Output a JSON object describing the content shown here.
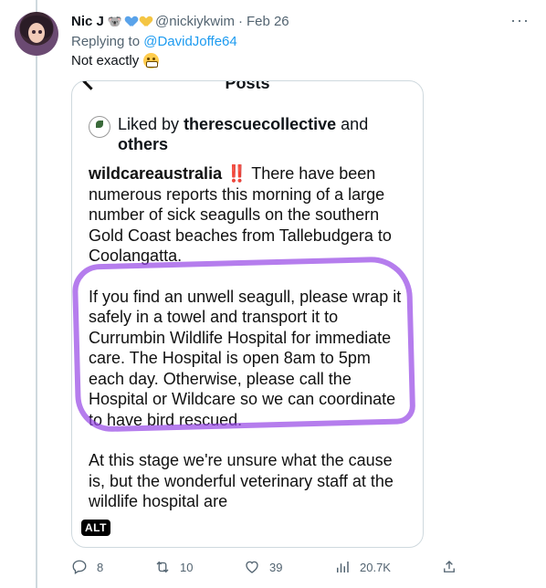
{
  "tweet": {
    "author_name": "Nic J",
    "author_handle": "@nickiykwim",
    "separator": "·",
    "date": "Feb 26",
    "replying_prefix": "Replying to",
    "replying_to": "@DavidJoffe64",
    "text": "Not exactly",
    "more": "···"
  },
  "media": {
    "alt_label": "ALT",
    "posts_title": "Posts",
    "liked_prefix": "Liked by",
    "liked_account": "therescuecollective",
    "liked_suffix_1": "and",
    "liked_suffix_2": "others",
    "post_user": "wildcareaustralia",
    "post_bang": "‼️",
    "paragraph_1": "There have been numerous reports this morning of a large number of sick seagulls on the southern Gold Coast beaches from Tallebudgera to Coolangatta.",
    "paragraph_2": "If you find an unwell seagull, please wrap it safely in a towel and transport it to Currumbin Wildlife Hospital for immediate care.  The Hospital is open 8am to 5pm each day.  Otherwise, please call the Hospital or Wildcare so we can coordinate to have bird rescued.",
    "paragraph_3": "At this stage we're unsure what the cause is, but the wonderful veterinary staff at the wildlife hospital are"
  },
  "actions": {
    "replies": "8",
    "retweets": "10",
    "likes": "39",
    "views": "20.7K"
  },
  "colors": {
    "link": "#1d9bf0",
    "muted": "#536471",
    "highlight": "#9646e6"
  }
}
